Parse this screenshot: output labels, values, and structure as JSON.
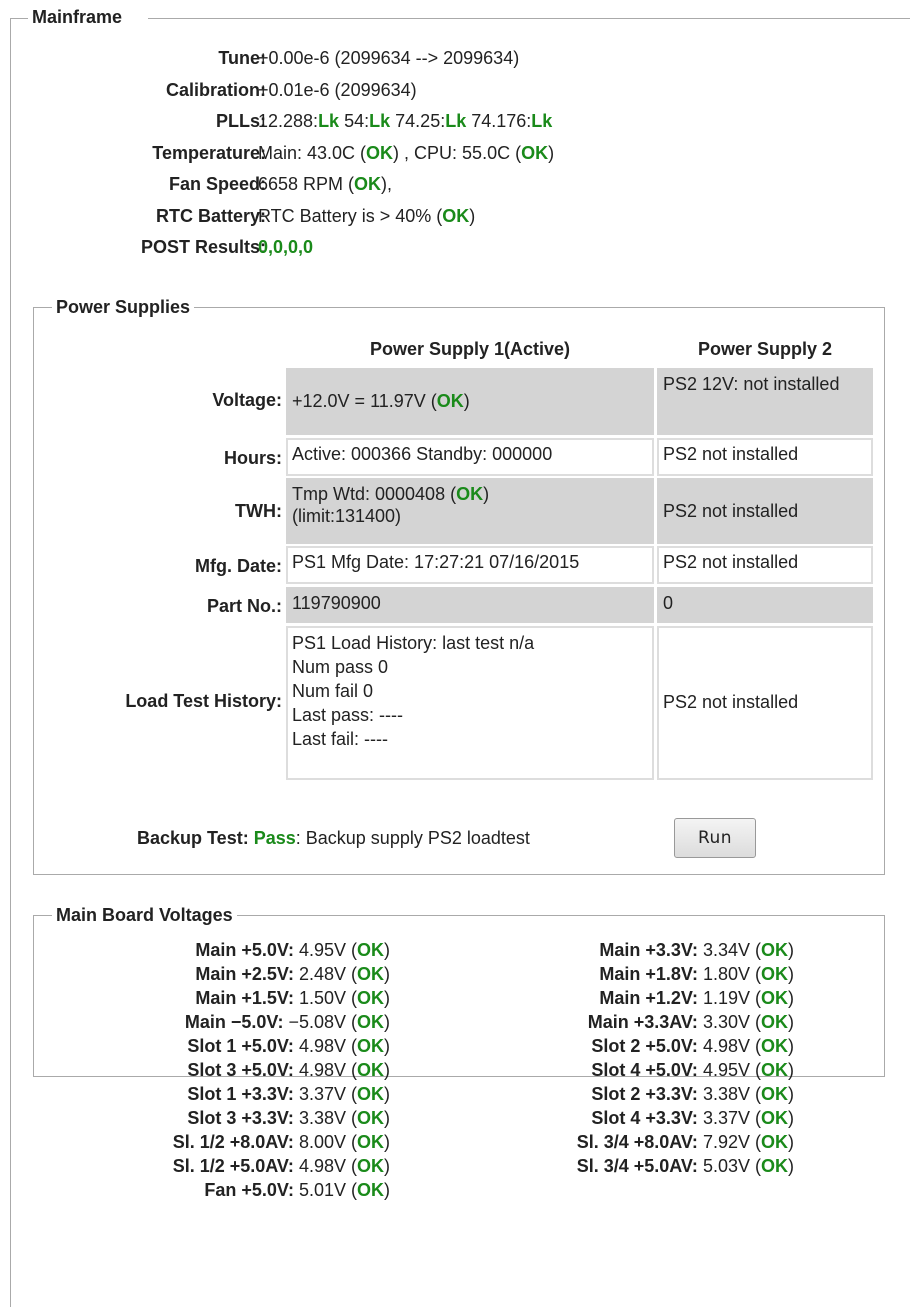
{
  "mainframe": {
    "legend": "Mainframe",
    "tune": {
      "label": "Tune:",
      "value": "+0.00e-6 (2099634 --> 2099634)"
    },
    "calibration": {
      "label": "Calibration:",
      "value": "+0.01e-6 (2099634)"
    },
    "plls": {
      "label": "PLLs:",
      "p1": "12.288:",
      "p2": "54:",
      "p3": "74.25:",
      "p4": "74.176:",
      "lk": "Lk"
    },
    "temperature": {
      "label": "Temperature:",
      "main": "Main: 43.0C (",
      "cpu": ") , CPU: 55.0C (",
      "end": ")",
      "ok": "OK"
    },
    "fan": {
      "label": "Fan Speed:",
      "value": "6658 RPM (",
      "end": "),",
      "ok": "OK"
    },
    "rtc": {
      "label": "RTC Battery:",
      "value": "RTC Battery is > 40% (",
      "end": ")",
      "ok": "OK"
    },
    "post": {
      "label": "POST Results:",
      "value": "0,0,0,0"
    }
  },
  "power_supplies": {
    "legend": "Power Supplies",
    "col1": "Power Supply 1(Active)",
    "col2": "Power Supply 2",
    "rows": {
      "voltage": {
        "label": "Voltage:",
        "ps1": "+12.0V = 11.97V (",
        "ps1_end": ")",
        "ps2": "PS2 12V: not installed"
      },
      "hours": {
        "label": "Hours:",
        "ps1": "Active: 000366 Standby: 000000",
        "ps2": "PS2 not installed"
      },
      "twh": {
        "label": "TWH:",
        "ps1a": "Tmp Wtd: 0000408 (",
        "ps1b": ")",
        "ps1c": "(limit:131400)",
        "ps2": "PS2 not installed"
      },
      "mfg": {
        "label": "Mfg. Date:",
        "ps1": "PS1 Mfg Date: 17:27:21 07/16/2015",
        "ps2": "PS2 not installed"
      },
      "part": {
        "label": "Part No.:",
        "ps1": "119790900",
        "ps2": "0"
      },
      "load": {
        "label": "Load Test History:",
        "l1": "PS1 Load History: last test n/a",
        "l2": "Num pass 0",
        "l3": "Num fail 0",
        "l4": "Last pass: ----",
        "l5": "Last fail: ----",
        "ps2": "PS2 not installed"
      }
    },
    "ok": "OK",
    "backup": {
      "label": "Backup Test:",
      "status": "Pass",
      "text": ": Backup supply PS2 loadtest"
    },
    "run_label": "Run"
  },
  "main_board": {
    "legend": "Main Board Voltages",
    "ok": "OK",
    "left": [
      {
        "label": "Main +5.0V:",
        "value": "4.95V ("
      },
      {
        "label": "Main +2.5V:",
        "value": "2.48V ("
      },
      {
        "label": "Main +1.5V:",
        "value": "1.50V ("
      },
      {
        "label": "Main −5.0V:",
        "value": "−5.08V ("
      },
      {
        "label": "Slot 1 +5.0V:",
        "value": "4.98V ("
      },
      {
        "label": "Slot 3 +5.0V:",
        "value": "4.98V ("
      },
      {
        "label": "Slot 1 +3.3V:",
        "value": "3.37V ("
      },
      {
        "label": "Slot 3 +3.3V:",
        "value": "3.38V ("
      },
      {
        "label": "Sl. 1/2 +8.0AV:",
        "value": "8.00V ("
      },
      {
        "label": "Sl. 1/2 +5.0AV:",
        "value": "4.98V ("
      },
      {
        "label": "Fan +5.0V:",
        "value": "5.01V ("
      }
    ],
    "right": [
      {
        "label": "Main +3.3V:",
        "value": "3.34V ("
      },
      {
        "label": "Main +1.8V:",
        "value": "1.80V ("
      },
      {
        "label": "Main +1.2V:",
        "value": "1.19V ("
      },
      {
        "label": "Main +3.3AV:",
        "value": "3.30V ("
      },
      {
        "label": "Slot 2 +5.0V:",
        "value": "4.98V ("
      },
      {
        "label": "Slot 4 +5.0V:",
        "value": "4.95V ("
      },
      {
        "label": "Slot 2 +3.3V:",
        "value": "3.38V ("
      },
      {
        "label": "Slot 4 +3.3V:",
        "value": "3.37V ("
      },
      {
        "label": "Sl. 3/4 +8.0AV:",
        "value": "7.92V ("
      },
      {
        "label": "Sl. 3/4 +5.0AV:",
        "value": "5.03V ("
      }
    ]
  },
  "colors": {
    "ok": "#1a8a1a",
    "cell_gray": "#d4d4d4",
    "border": "#aaaaaa"
  }
}
